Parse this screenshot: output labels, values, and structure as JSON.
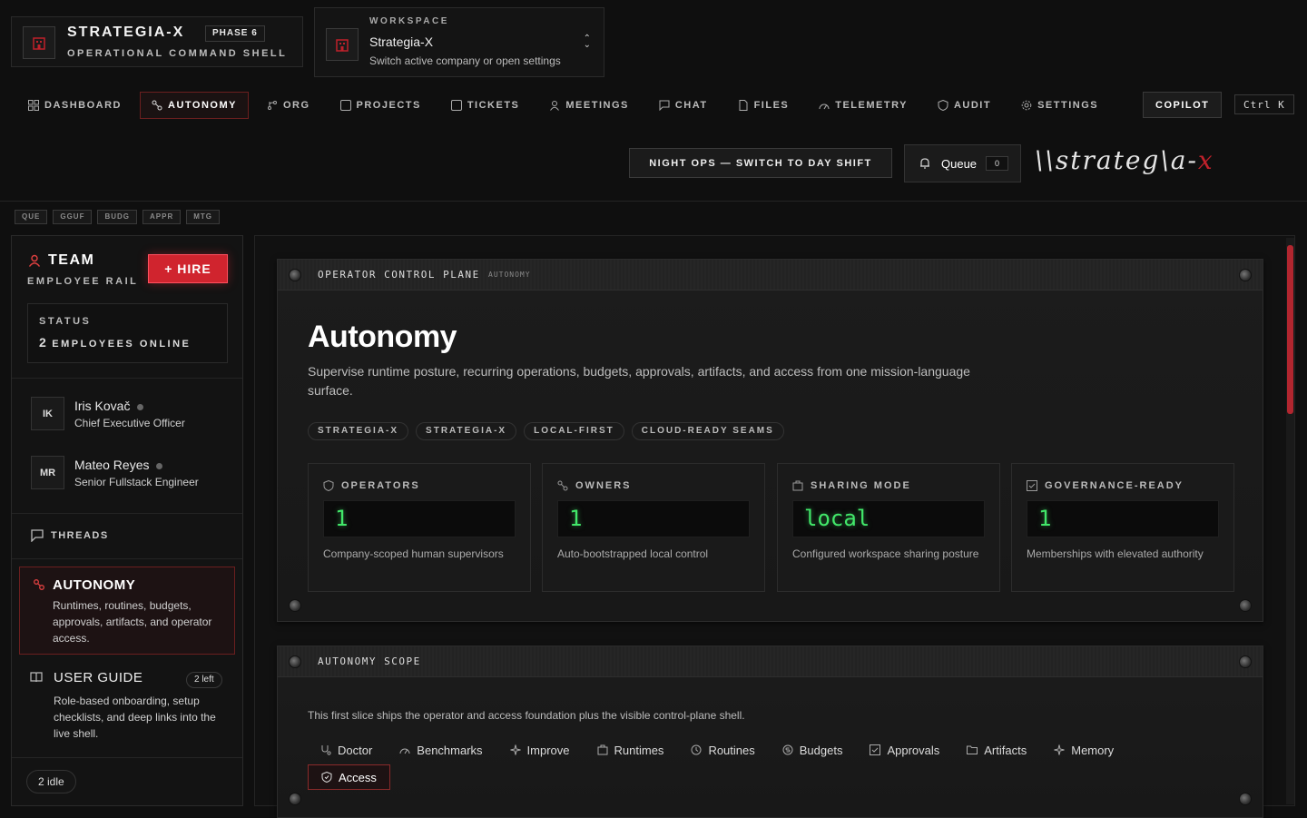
{
  "brand": {
    "title": "STRATEGIA-X",
    "phase": "PHASE 6",
    "subtitle": "OPERATIONAL COMMAND SHELL"
  },
  "workspace": {
    "label": "WORKSPACE",
    "name": "Strategia-X",
    "hint": "Switch active company or open settings"
  },
  "nav": {
    "items": [
      {
        "label": "DASHBOARD",
        "icon": "grid-icon"
      },
      {
        "label": "AUTONOMY",
        "icon": "nodes-icon",
        "active": true
      },
      {
        "label": "ORG",
        "icon": "branch-icon"
      },
      {
        "label": "PROJECTS",
        "icon": "folder-icon"
      },
      {
        "label": "TICKETS",
        "icon": "ticket-icon"
      },
      {
        "label": "MEETINGS",
        "icon": "people-icon"
      },
      {
        "label": "CHAT",
        "icon": "chat-icon"
      },
      {
        "label": "FILES",
        "icon": "file-icon"
      },
      {
        "label": "TELEMETRY",
        "icon": "gauge-icon"
      },
      {
        "label": "AUDIT",
        "icon": "shield-icon"
      },
      {
        "label": "SETTINGS",
        "icon": "gear-icon"
      }
    ],
    "copilot": "COPILOT",
    "shortcut": "Ctrl K"
  },
  "night_ops": "NIGHT OPS — SWITCH TO DAY SHIFT",
  "queue": {
    "label": "Queue",
    "count": "0"
  },
  "logo": {
    "main": "\\\\strateg\\a-",
    "accent": "x"
  },
  "chips": [
    "QUE",
    "GGUF",
    "BUDG",
    "APPR",
    "MTG"
  ],
  "sidebar": {
    "team": "TEAM",
    "rail": "EMPLOYEE RAIL",
    "hire": "+ HIRE",
    "status_label": "STATUS",
    "online_count": "2",
    "online_text": "EMPLOYEES ONLINE",
    "employees": [
      {
        "initials": "IK",
        "name": "Iris Kovač",
        "role": "Chief Executive Officer"
      },
      {
        "initials": "MR",
        "name": "Mateo Reyes",
        "role": "Senior Fullstack Engineer"
      }
    ],
    "threads": "THREADS",
    "autonomy": {
      "title": "AUTONOMY",
      "desc": "Runtimes, routines, budgets, approvals, artifacts, and operator access."
    },
    "guide": {
      "title": "USER GUIDE",
      "badge": "2 left",
      "desc": "Role-based onboarding, setup checklists, and deep links into the live shell."
    },
    "idle": "2 idle"
  },
  "control_plane": {
    "header": "OPERATOR CONTROL PLANE",
    "tag": "AUTONOMY",
    "title": "Autonomy",
    "lead": "Supervise runtime posture, recurring operations, budgets, approvals, artifacts, and access from one mission-language surface.",
    "tags": [
      "STRATEGIA-X",
      "STRATEGIA-X",
      "LOCAL-FIRST",
      "CLOUD-READY SEAMS"
    ],
    "stats": [
      {
        "label": "OPERATORS",
        "value": "1",
        "desc": "Company-scoped human supervisors",
        "icon": "shield-icon"
      },
      {
        "label": "OWNERS",
        "value": "1",
        "desc": "Auto-bootstrapped local control",
        "icon": "nodes-icon"
      },
      {
        "label": "SHARING MODE",
        "value": "local",
        "desc": "Configured workspace sharing posture",
        "icon": "box-icon"
      },
      {
        "label": "GOVERNANCE-READY",
        "value": "1",
        "desc": "Memberships with elevated authority",
        "icon": "check-icon"
      }
    ]
  },
  "scope": {
    "header": "AUTONOMY SCOPE",
    "text": "This first slice ships the operator and access foundation plus the visible control-plane shell.",
    "links": [
      "Doctor",
      "Benchmarks",
      "Improve",
      "Runtimes",
      "Routines",
      "Budgets",
      "Approvals",
      "Artifacts",
      "Memory"
    ],
    "access": "Access"
  },
  "colors": {
    "accent": "#d0242e",
    "lcd": "#42e86a",
    "background": "#0f0f0f"
  }
}
